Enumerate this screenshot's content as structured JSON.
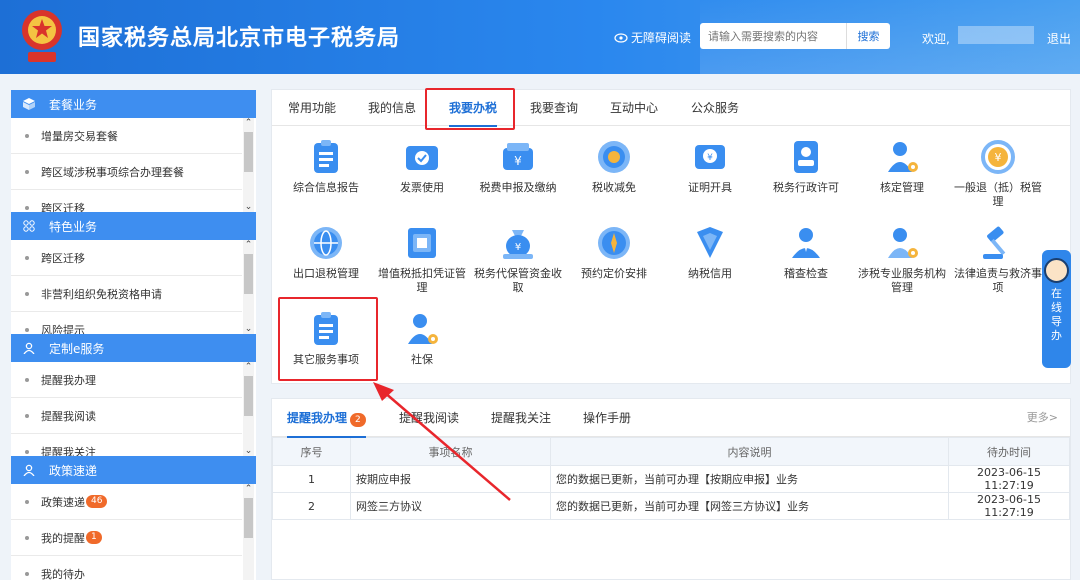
{
  "header": {
    "title": "国家税务总局北京市电子税务局",
    "accessibility_label": "无障碍阅读",
    "search_placeholder": "请输入需要搜索的内容",
    "search_button": "搜索",
    "welcome": "欢迎,",
    "logout": "退出"
  },
  "sidebar": {
    "sections": [
      {
        "title": "套餐业务",
        "icon": "cube-icon",
        "items": [
          "增量房交易套餐",
          "跨区域涉税事项综合办理套餐",
          "跨区迁移"
        ]
      },
      {
        "title": "特色业务",
        "icon": "grid-icon",
        "items": [
          "跨区迁移",
          "非营利组织免税资格申请",
          "风险提示"
        ]
      },
      {
        "title": "定制e服务",
        "icon": "user-icon",
        "items": [
          "提醒我办理",
          "提醒我阅读",
          "提醒我关注"
        ]
      },
      {
        "title": "政策速递",
        "icon": "user-icon",
        "items": [
          "政策速递",
          "我的提醒",
          "我的待办"
        ],
        "badges": [
          "46",
          "1",
          ""
        ]
      }
    ]
  },
  "main": {
    "tabs": [
      "常用功能",
      "我的信息",
      "我要办税",
      "我要查询",
      "互动中心",
      "公众服务"
    ],
    "active_tab": "我要办税",
    "tiles": [
      {
        "label": "综合信息报告",
        "icon": "clipboard-icon"
      },
      {
        "label": "发票使用",
        "icon": "invoice-icon"
      },
      {
        "label": "税费申报及缴纳",
        "icon": "wallet-icon"
      },
      {
        "label": "税收减免",
        "icon": "coin-icon"
      },
      {
        "label": "证明开具",
        "icon": "certificate-icon"
      },
      {
        "label": "税务行政许可",
        "icon": "id-card-icon"
      },
      {
        "label": "核定管理",
        "icon": "user-gear-icon"
      },
      {
        "label": "一般退（抵）税管理",
        "icon": "refund-icon"
      },
      {
        "label": "出口退税管理",
        "icon": "globe-icon"
      },
      {
        "label": "增值税抵扣凭证管理",
        "icon": "voucher-icon"
      },
      {
        "label": "税务代保管资金收取",
        "icon": "money-bag-icon"
      },
      {
        "label": "预约定价安排",
        "icon": "compass-icon"
      },
      {
        "label": "纳税信用",
        "icon": "shield-icon"
      },
      {
        "label": "稽查检查",
        "icon": "inspector-icon"
      },
      {
        "label": "涉税专业服务机构管理",
        "icon": "agent-gear-icon"
      },
      {
        "label": "法律追责与救济事项",
        "icon": "gavel-icon"
      },
      {
        "label": "其它服务事项",
        "icon": "clipboard-icon"
      },
      {
        "label": "社保",
        "icon": "user-gear-icon"
      }
    ]
  },
  "reminders": {
    "tabs": [
      "提醒我办理",
      "提醒我阅读",
      "提醒我关注",
      "操作手册"
    ],
    "active_badge": "2",
    "more": "更多>",
    "columns": [
      "序号",
      "事项名称",
      "内容说明",
      "待办时间"
    ],
    "rows": [
      [
        "1",
        "按期应申报",
        "您的数据已更新，当前可办理【按期应申报】业务",
        "2023-06-15 11:27:19"
      ],
      [
        "2",
        "网签三方协议",
        "您的数据已更新，当前可办理【网签三方协议】业务",
        "2023-06-15 11:27:19"
      ]
    ]
  },
  "float_guide": {
    "label": "在线导办"
  },
  "colors": {
    "header": "#1d6fd6",
    "accent": "#3e8ef0",
    "highlight": "#e8262c",
    "badge": "#f06a2a"
  }
}
